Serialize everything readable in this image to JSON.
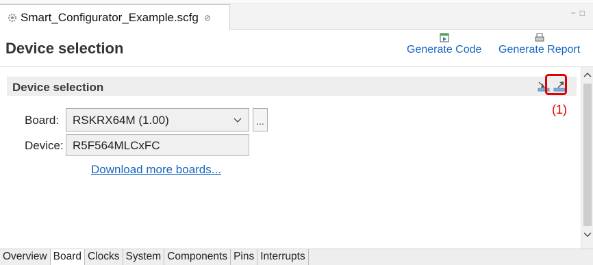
{
  "editor_tab": {
    "filename": "Smart_Configurator_Example.scfg",
    "close_glyph": "⊘"
  },
  "window_controls": {
    "minimize": "−",
    "maximize": "□"
  },
  "header": {
    "title": "Device selection",
    "generate_code_label": "Generate Code",
    "generate_report_label": "Generate Report"
  },
  "section": {
    "title": "Device selection"
  },
  "annotation": {
    "label": "(1)",
    "color": "#e00000"
  },
  "form": {
    "board_label": "Board:",
    "board_value": "RSKRX64M (1.00)",
    "browse_label": "...",
    "device_label": "Device:",
    "device_value": "R5F564MLCxFC",
    "download_link": "Download more boards..."
  },
  "bottom_tabs": [
    {
      "label": "Overview",
      "active": false
    },
    {
      "label": "Board",
      "active": true
    },
    {
      "label": "Clocks",
      "active": false
    },
    {
      "label": "System",
      "active": false
    },
    {
      "label": "Components",
      "active": false
    },
    {
      "label": "Pins",
      "active": false
    },
    {
      "label": "Interrupts",
      "active": false
    }
  ],
  "colors": {
    "link": "#1565c0",
    "highlight": "#e00000",
    "section_bg": "#eeeeee"
  },
  "icons": [
    "gear-icon",
    "generate-code-icon",
    "generate-report-icon",
    "import-board-icon",
    "export-board-icon",
    "chevron-down-icon",
    "scroll-up-icon",
    "scroll-down-icon"
  ]
}
